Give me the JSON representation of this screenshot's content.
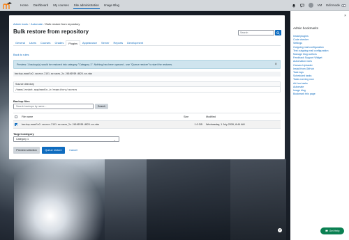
{
  "topnav": {
    "links": [
      "Home",
      "Dashboard",
      "My courses",
      "Site administration",
      "Image Blog"
    ],
    "active_index": 3,
    "user_initials": "VM",
    "edit_mode_label": "Edit mode"
  },
  "breadcrumb": [
    "Admin tools",
    "Automate",
    "Bulk restore from repository"
  ],
  "page_title": "Bulk restore from repository",
  "search": {
    "placeholder": "Search"
  },
  "tabs": [
    "General",
    "Users",
    "Courses",
    "Grades",
    "Plugins",
    "Appearance",
    "Server",
    "Reports",
    "Development"
  ],
  "active_tab": 4,
  "back_link": "Back to rules",
  "alert": {
    "text": "Preview: 1 backup(s) would be restored into category \"Category 1\". Nothing has been queued - use \"Queue restore\" to start the restores.",
    "close_glyph": "×"
  },
  "selected_file": "backup-moodle2-course-2151-accuses_2x-20160709-0825-an.mbz",
  "source": {
    "heading": "Source directory",
    "path": "/home/jrosbot-app/moodle_jr/repository/courses"
  },
  "backup_files": {
    "heading": "Backup files",
    "search_placeholder": "Search backups by name...",
    "search_button": "Search",
    "columns": [
      "File name",
      "Size",
      "Modified"
    ],
    "rows": [
      {
        "checked": true,
        "name": "backup-moodle2-course-2151-accuses_2x-20160709-0825-an.mbz",
        "size": "1.0 GB",
        "modified": "Wednesday, 1 July 2026, 8:44 AM"
      }
    ]
  },
  "target": {
    "heading": "Target category",
    "selected": "Category 1",
    "chevron": "⌄"
  },
  "actions": {
    "preview": "Preview selection",
    "queue": "Queue restore",
    "cancel": "Cancel"
  },
  "drawer": {
    "title": "Admin bookmarks",
    "close_glyph": "×",
    "items": [
      "Install plugins",
      "Code checker",
      "Settings",
      "Outgoing mail configuration",
      "Test outgoing mail configuration",
      "Manage blog authors",
      "Feedback Support Widget",
      "Automation rules",
      "Canvas Uploader",
      "Install from GitHub",
      "Task logs",
      "Scheduled tasks",
      "Tasks running now",
      "Ad-hoc tasks",
      "Automate",
      "Image blog",
      "Bookmark this page"
    ]
  },
  "help_glyph": "?",
  "get_help": "Get Help",
  "colors": {
    "brand": "#0f6cbf",
    "help_green": "#0b8052",
    "alert_bg": "#cfe4ee"
  }
}
